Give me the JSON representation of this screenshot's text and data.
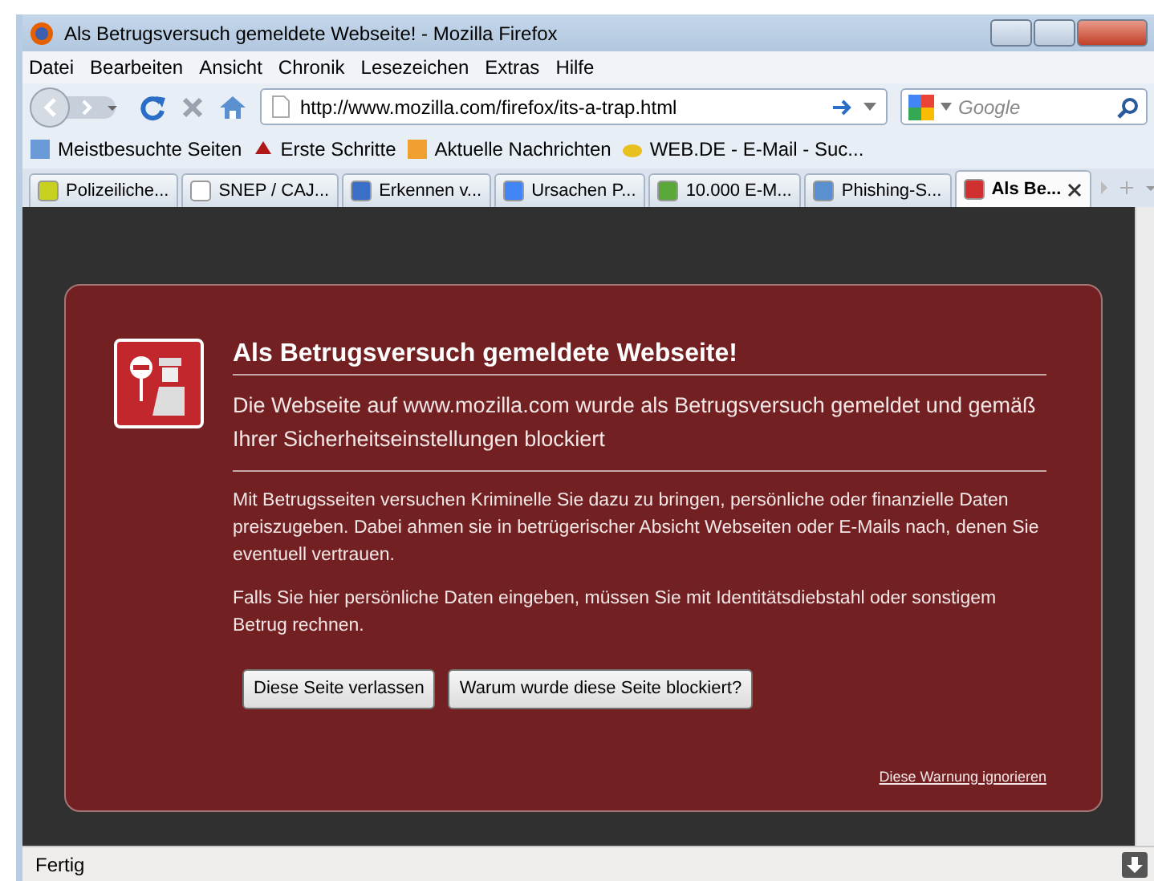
{
  "window": {
    "title": "Als Betrugsversuch gemeldete Webseite! - Mozilla Firefox"
  },
  "menu": [
    "Datei",
    "Bearbeiten",
    "Ansicht",
    "Chronik",
    "Lesezeichen",
    "Extras",
    "Hilfe"
  ],
  "toolbar": {
    "url": "http://www.mozilla.com/firefox/its-a-trap.html",
    "search_placeholder": "Google"
  },
  "bookmarks": [
    "Meistbesuchte Seiten",
    "Erste Schritte",
    "Aktuelle Nachrichten",
    "WEB.DE - E-Mail - Suc..."
  ],
  "tabs": [
    {
      "label": "Polizeiliche...",
      "selected": false
    },
    {
      "label": "SNEP / CAJ...",
      "selected": false
    },
    {
      "label": "Erkennen v...",
      "selected": false
    },
    {
      "label": "Ursachen P...",
      "selected": false
    },
    {
      "label": "10.000 E-M...",
      "selected": false
    },
    {
      "label": "Phishing-S...",
      "selected": false
    },
    {
      "label": "Als Be...",
      "selected": true
    }
  ],
  "page": {
    "title": "Als Betrugsversuch gemeldete Webseite!",
    "intro": "Die Webseite auf www.mozilla.com wurde als Betrugsversuch gemeldet und gemäß Ihrer Sicherheitseinstellungen blockiert",
    "paragraphs": [
      "Mit Betrugsseiten versuchen Kriminelle Sie dazu zu bringen, persönliche oder finanzielle Daten preiszugeben. Dabei ahmen sie in betrügerischer Absicht Webseiten oder E-Mails nach, denen Sie eventuell vertrauen.",
      "Falls Sie hier persönliche Daten eingeben, müssen Sie mit Identitätsdiebstahl oder sonstigem Betrug rechnen."
    ],
    "buttons": [
      "Diese Seite verlassen",
      "Warum wurde diese Seite blockiert?"
    ],
    "ignore_link": "Diese Warnung ignorieren"
  },
  "status_bar": {
    "text": "Fertig"
  }
}
